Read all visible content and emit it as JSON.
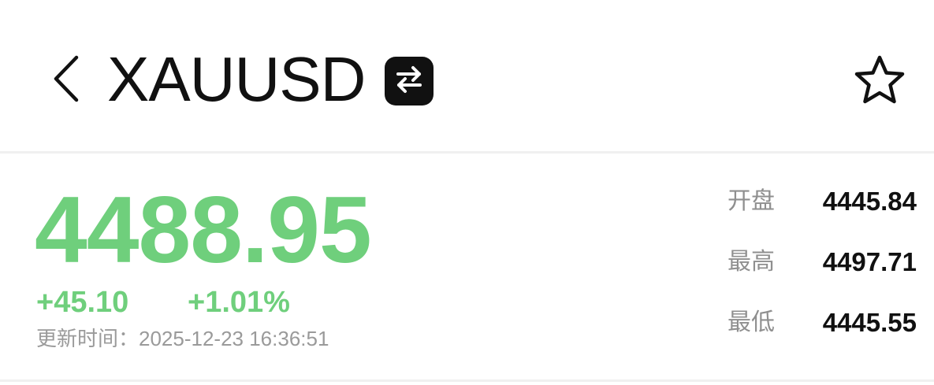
{
  "header": {
    "title": "XAUUSD",
    "back_icon": "chevron-left-icon",
    "swap_icon": "swap-arrows-icon",
    "favorite_icon": "star-outline-icon"
  },
  "quote": {
    "price": "4488.95",
    "change": "+45.10",
    "change_percent": "+1.01%",
    "update_time": "更新时间：2025-12-23 16:36:51",
    "accent_color": "#6fcf7c"
  },
  "stats": [
    {
      "label": "开盘",
      "value": "4445.84"
    },
    {
      "label": "最高",
      "value": "4497.71"
    },
    {
      "label": "最低",
      "value": "4445.55"
    }
  ]
}
